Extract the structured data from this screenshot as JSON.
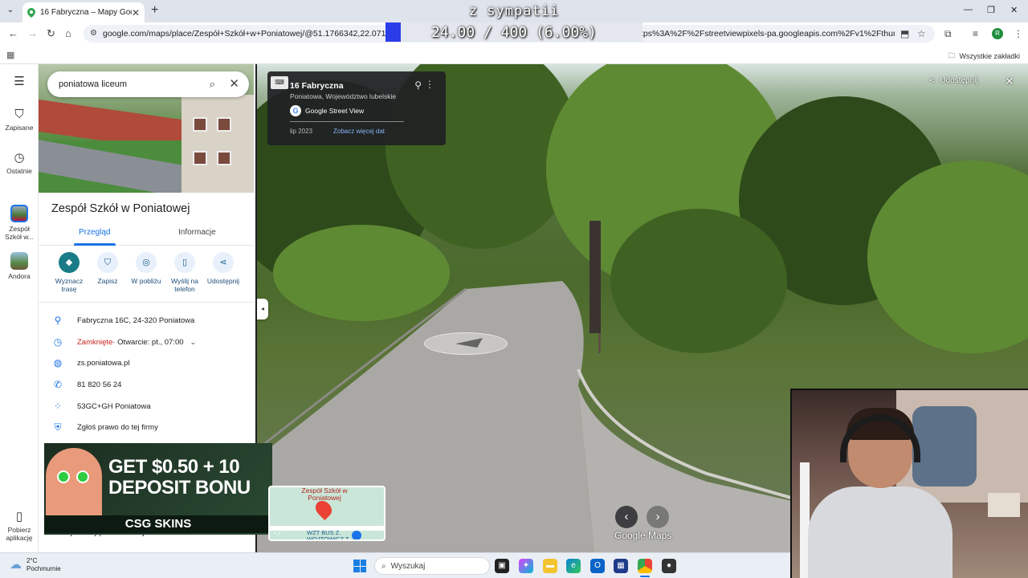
{
  "browser": {
    "tab_title": "16 Fabryczna – Mapy Google",
    "tab_close": "✕",
    "new_tab": "+",
    "url_left": "google.com/maps/place/Zespół+Szkół+w+Poniatowej/@51.1766342,22.0716752,3a,7",
    "url_right": "tps%3A%2F%2Fstreetviewpixels-pa.googleapis.com%2Fv1%2Fthumbnail%3Fc...",
    "all_bookmarks": "Wszystkie zakładki",
    "profile_initial": "R",
    "window_controls": [
      "—",
      "❐",
      "✕"
    ]
  },
  "stream_overlay": {
    "title": "z sympatii",
    "progress_text": "24.00 / 400 (6.00%)",
    "progress_fraction": 0.06
  },
  "rail": {
    "items": [
      {
        "label": "Zapisane",
        "icon": "bookmark-icon"
      },
      {
        "label": "Ostatnie",
        "icon": "history-icon"
      },
      {
        "label": "Zespół Szkół w...",
        "icon": "place-thumbnail"
      },
      {
        "label": "Andora",
        "icon": "place-thumbnail"
      }
    ],
    "bottom_label": "Pobierz aplikację"
  },
  "panel": {
    "search_value": "poniatowa liceum",
    "place_name": "Zespół Szkół w Poniatowej",
    "tabs": [
      {
        "label": "Przegląd",
        "active": true
      },
      {
        "label": "Informacje",
        "active": false
      }
    ],
    "actions": [
      {
        "label": "Wyznacz trasę",
        "icon": "directions-icon"
      },
      {
        "label": "Zapisz",
        "icon": "bookmark-icon"
      },
      {
        "label": "W pobliżu",
        "icon": "nearby-icon"
      },
      {
        "label": "Wyślij na telefon",
        "icon": "phone-send-icon"
      },
      {
        "label": "Udostępnij",
        "icon": "share-icon"
      }
    ],
    "address": "Fabryczna 16C, 24-320 Poniatowa",
    "hours_status": "Zamknięte",
    "hours_detail": " · Otwarcie: pt., 07:00",
    "website": "zs.poniatowa.pl",
    "phone": "81 820 56 24",
    "plus_code": "53GC+GH Poniatowa",
    "claim": "Zgłoś prawo do tej firmy",
    "missing_info": "Dodaj brakujące informacje"
  },
  "ad": {
    "line1": "GET $0.50 + 10",
    "line2": "DEPOSIT BONU",
    "brand": "CSG SKINS"
  },
  "streetview": {
    "title": "16 Fabryczna",
    "subtitle": "Poniatowa, Województwo lubelskie",
    "source": "Google Street View",
    "date": "lip 2023",
    "more_dates": "Zobacz więcej dat",
    "share": "Udostępnij",
    "logo": "Google Maps"
  },
  "minimap": {
    "label": "Zespół Szkół w Poniatowej",
    "bus_label": "WZT BUS Z. WOJTOWICZ T."
  },
  "taskbar": {
    "temp": "2°C",
    "weather": "Pochmurnie",
    "search": "Wyszukaj"
  },
  "colors": {
    "accent": "#1a73e8",
    "progress": "#2b3de8",
    "closed": "#c5221f",
    "primary_action": "#1a7b88"
  }
}
